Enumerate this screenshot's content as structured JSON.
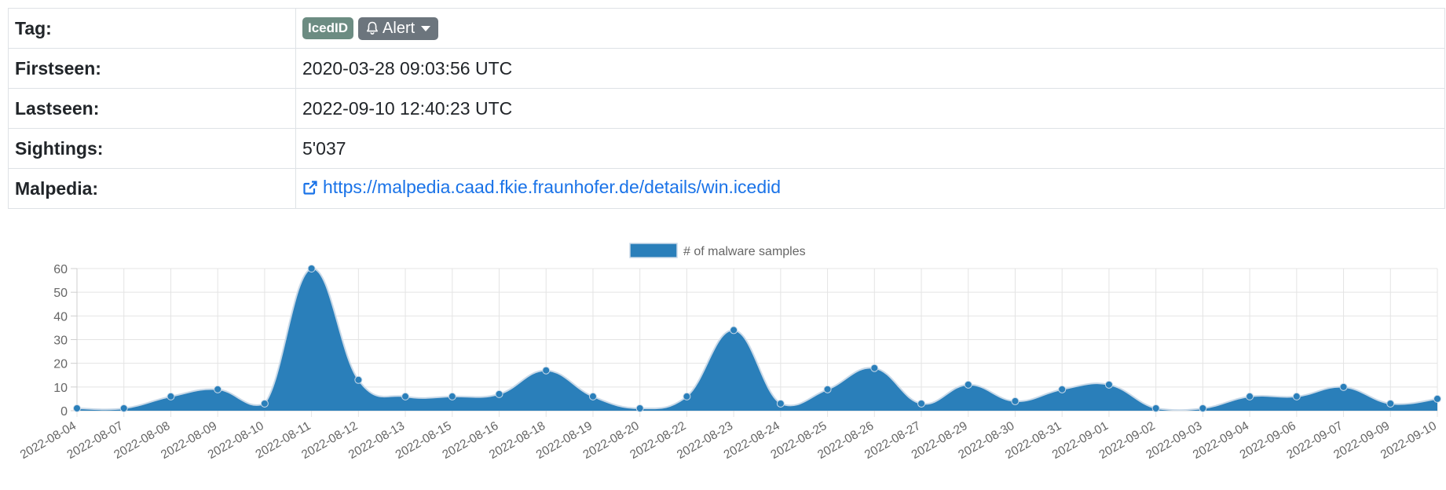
{
  "details": {
    "tag_key": "Tag:",
    "tag_badge": "IcedID",
    "alert_label": "Alert",
    "firstseen_key": "Firstseen:",
    "firstseen_value": "2020-03-28 09:03:56 UTC",
    "lastseen_key": "Lastseen:",
    "lastseen_value": "2022-09-10 12:40:23 UTC",
    "sightings_key": "Sightings:",
    "sightings_value": "5'037",
    "malpedia_key": "Malpedia:",
    "malpedia_url": "https://malpedia.caad.fkie.fraunhofer.de/details/win.icedid"
  },
  "chart_data": {
    "type": "area",
    "title": "",
    "xlabel": "",
    "ylabel": "",
    "ylim": [
      0,
      60
    ],
    "yticks": [
      0,
      10,
      20,
      30,
      40,
      50,
      60
    ],
    "grid": true,
    "legend_position": "top-center",
    "categories": [
      "2022-08-04",
      "2022-08-07",
      "2022-08-08",
      "2022-08-09",
      "2022-08-10",
      "2022-08-11",
      "2022-08-12",
      "2022-08-13",
      "2022-08-15",
      "2022-08-16",
      "2022-08-18",
      "2022-08-19",
      "2022-08-20",
      "2022-08-22",
      "2022-08-23",
      "2022-08-24",
      "2022-08-25",
      "2022-08-26",
      "2022-08-27",
      "2022-08-29",
      "2022-08-30",
      "2022-08-31",
      "2022-09-01",
      "2022-09-02",
      "2022-09-03",
      "2022-09-04",
      "2022-09-06",
      "2022-09-07",
      "2022-09-09",
      "2022-09-10"
    ],
    "series": [
      {
        "name": "# of malware samples",
        "color": "#2a7fba",
        "values": [
          1,
          1,
          6,
          9,
          3,
          60,
          13,
          6,
          6,
          7,
          17,
          6,
          1,
          6,
          34,
          3,
          9,
          18,
          3,
          11,
          4,
          9,
          11,
          1,
          1,
          6,
          6,
          10,
          3,
          5
        ]
      }
    ]
  }
}
